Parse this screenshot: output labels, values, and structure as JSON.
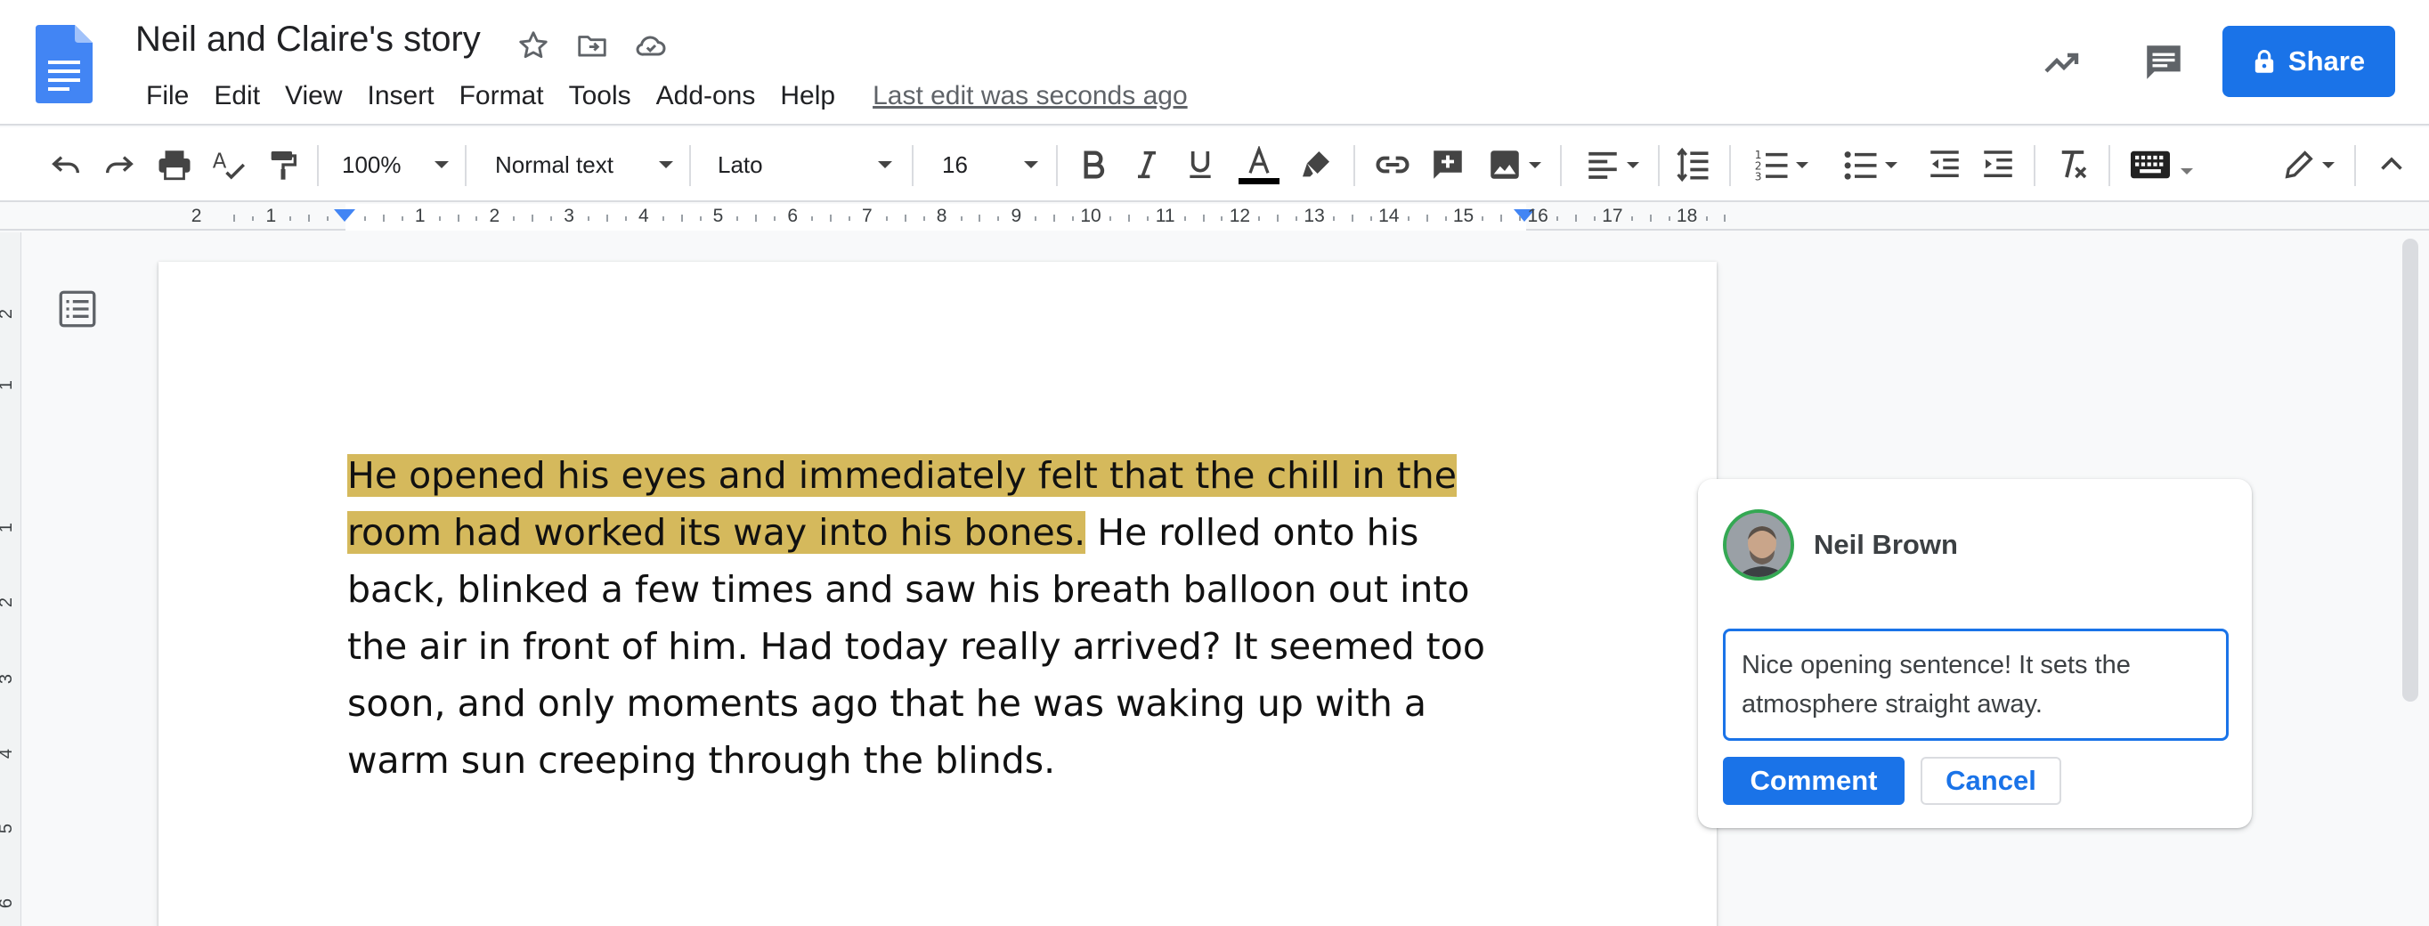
{
  "document": {
    "title": "Neil and Claire's story",
    "last_edit": "Last edit was seconds ago"
  },
  "menu": [
    "File",
    "Edit",
    "View",
    "Insert",
    "Format",
    "Tools",
    "Add-ons",
    "Help"
  ],
  "header": {
    "share_label": "Share"
  },
  "toolbar": {
    "zoom": "100%",
    "style": "Normal text",
    "font": "Lato",
    "font_size": "16"
  },
  "ruler": {
    "left_numbers": [
      "2",
      "1"
    ],
    "right_numbers": [
      "1",
      "2",
      "3",
      "4",
      "5",
      "6",
      "7",
      "8",
      "9",
      "10",
      "11",
      "12",
      "13",
      "14",
      "15",
      "16",
      "17",
      "18"
    ]
  },
  "vertical_ruler": [
    "2",
    "1",
    "1",
    "2",
    "3",
    "4",
    "5",
    "6"
  ],
  "content": {
    "highlighted": "He opened his eyes and immediately felt that the chill in the room had worked its way into his bones.",
    "rest": " He rolled onto his back, blinked a few times and saw his breath balloon out into the air in front of him. Had today really arrived? It seemed too soon, and only moments ago that he was waking up with a warm sun creeping through the blinds."
  },
  "comment": {
    "author": "Neil Brown",
    "text": "Nice opening sentence! It sets the atmosphere straight away.",
    "comment_button": "Comment",
    "cancel_button": "Cancel"
  },
  "colors": {
    "accent": "#1a73e8",
    "highlight": "#d5b95c",
    "avatar_ring": "#34a853"
  }
}
